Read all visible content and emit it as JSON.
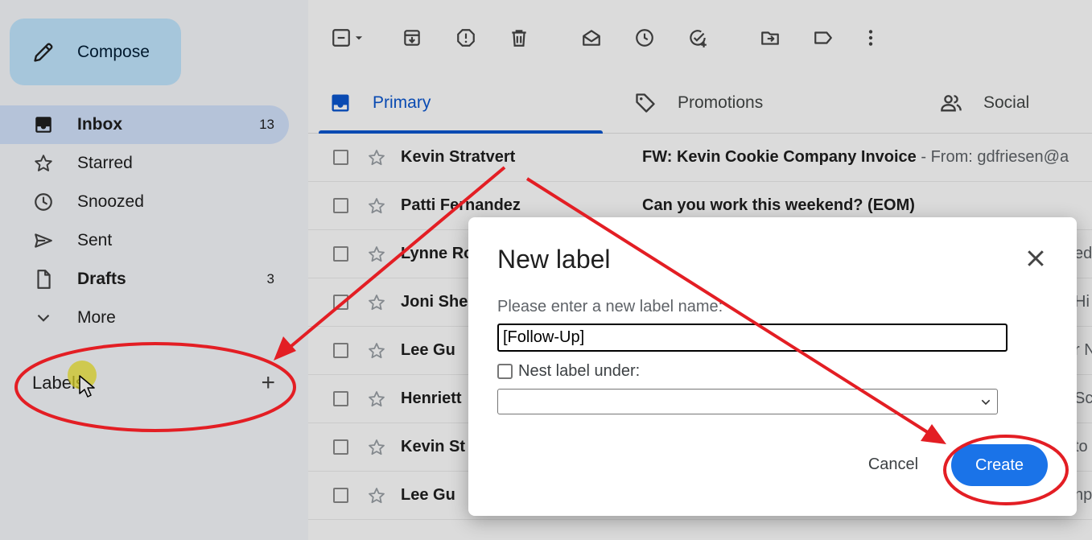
{
  "compose": {
    "label": "Compose",
    "icon": "pencil-icon"
  },
  "sidebar": {
    "items": [
      {
        "label": "Inbox",
        "count": "13",
        "icon": "inbox-icon",
        "active": true,
        "bold": true
      },
      {
        "label": "Starred",
        "count": "",
        "icon": "star-icon",
        "active": false,
        "bold": false
      },
      {
        "label": "Snoozed",
        "count": "",
        "icon": "clock-icon",
        "active": false,
        "bold": false
      },
      {
        "label": "Sent",
        "count": "",
        "icon": "send-icon",
        "active": false,
        "bold": false
      },
      {
        "label": "Drafts",
        "count": "3",
        "icon": "file-icon",
        "active": false,
        "bold": true
      },
      {
        "label": "More",
        "count": "",
        "icon": "chevron-down-icon",
        "active": false,
        "bold": false
      }
    ],
    "labels_heading": "Labels",
    "add_label_symbol": "+"
  },
  "toolbar": {
    "icons": [
      "select-all-checkbox-icon",
      "archive-icon",
      "report-spam-icon",
      "delete-icon",
      "mark-as-read-icon",
      "snooze-icon",
      "add-to-tasks-icon",
      "move-to-icon",
      "labels-icon",
      "more-vert-icon"
    ]
  },
  "tabs": [
    {
      "label": "Primary",
      "icon": "inbox-icon",
      "active": true
    },
    {
      "label": "Promotions",
      "icon": "tag-icon",
      "active": false
    },
    {
      "label": "Social",
      "icon": "people-icon",
      "active": false
    }
  ],
  "emails": [
    {
      "sender": "Kevin Stratvert",
      "subject": "FW: Kevin Cookie Company Invoice",
      "snippet": " - From: gdfriesen@a",
      "tail": ""
    },
    {
      "sender": "Patti Fernandez",
      "subject": "Can you work this weekend? (EOM)",
      "snippet": "",
      "tail": ""
    },
    {
      "sender": "Lynne Ro",
      "subject": "",
      "snippet": "",
      "tail": "ed"
    },
    {
      "sender": "Joni She",
      "subject": "",
      "snippet": "",
      "tail": "Hi"
    },
    {
      "sender": "Lee Gu",
      "subject": "",
      "snippet": "",
      "tail": "r N"
    },
    {
      "sender": "Henriett",
      "subject": "",
      "snippet": "",
      "tail": "Sc"
    },
    {
      "sender": "Kevin St",
      "subject": "",
      "snippet": "",
      "tail": "to"
    },
    {
      "sender": "Lee Gu",
      "subject": "",
      "snippet": "",
      "tail": "np"
    }
  ],
  "dialog": {
    "title": "New label",
    "prompt": "Please enter a new label name:",
    "input_value": "[Follow-Up]",
    "nest_label": "Nest label under:",
    "nest_checked": false,
    "select_value": "",
    "cancel_label": "Cancel",
    "create_label": "Create"
  },
  "colors": {
    "accent_blue": "#0b57d0",
    "create_button": "#1a73e8",
    "compose_bg": "#c2e7ff",
    "annotation_red": "#e31e24"
  }
}
